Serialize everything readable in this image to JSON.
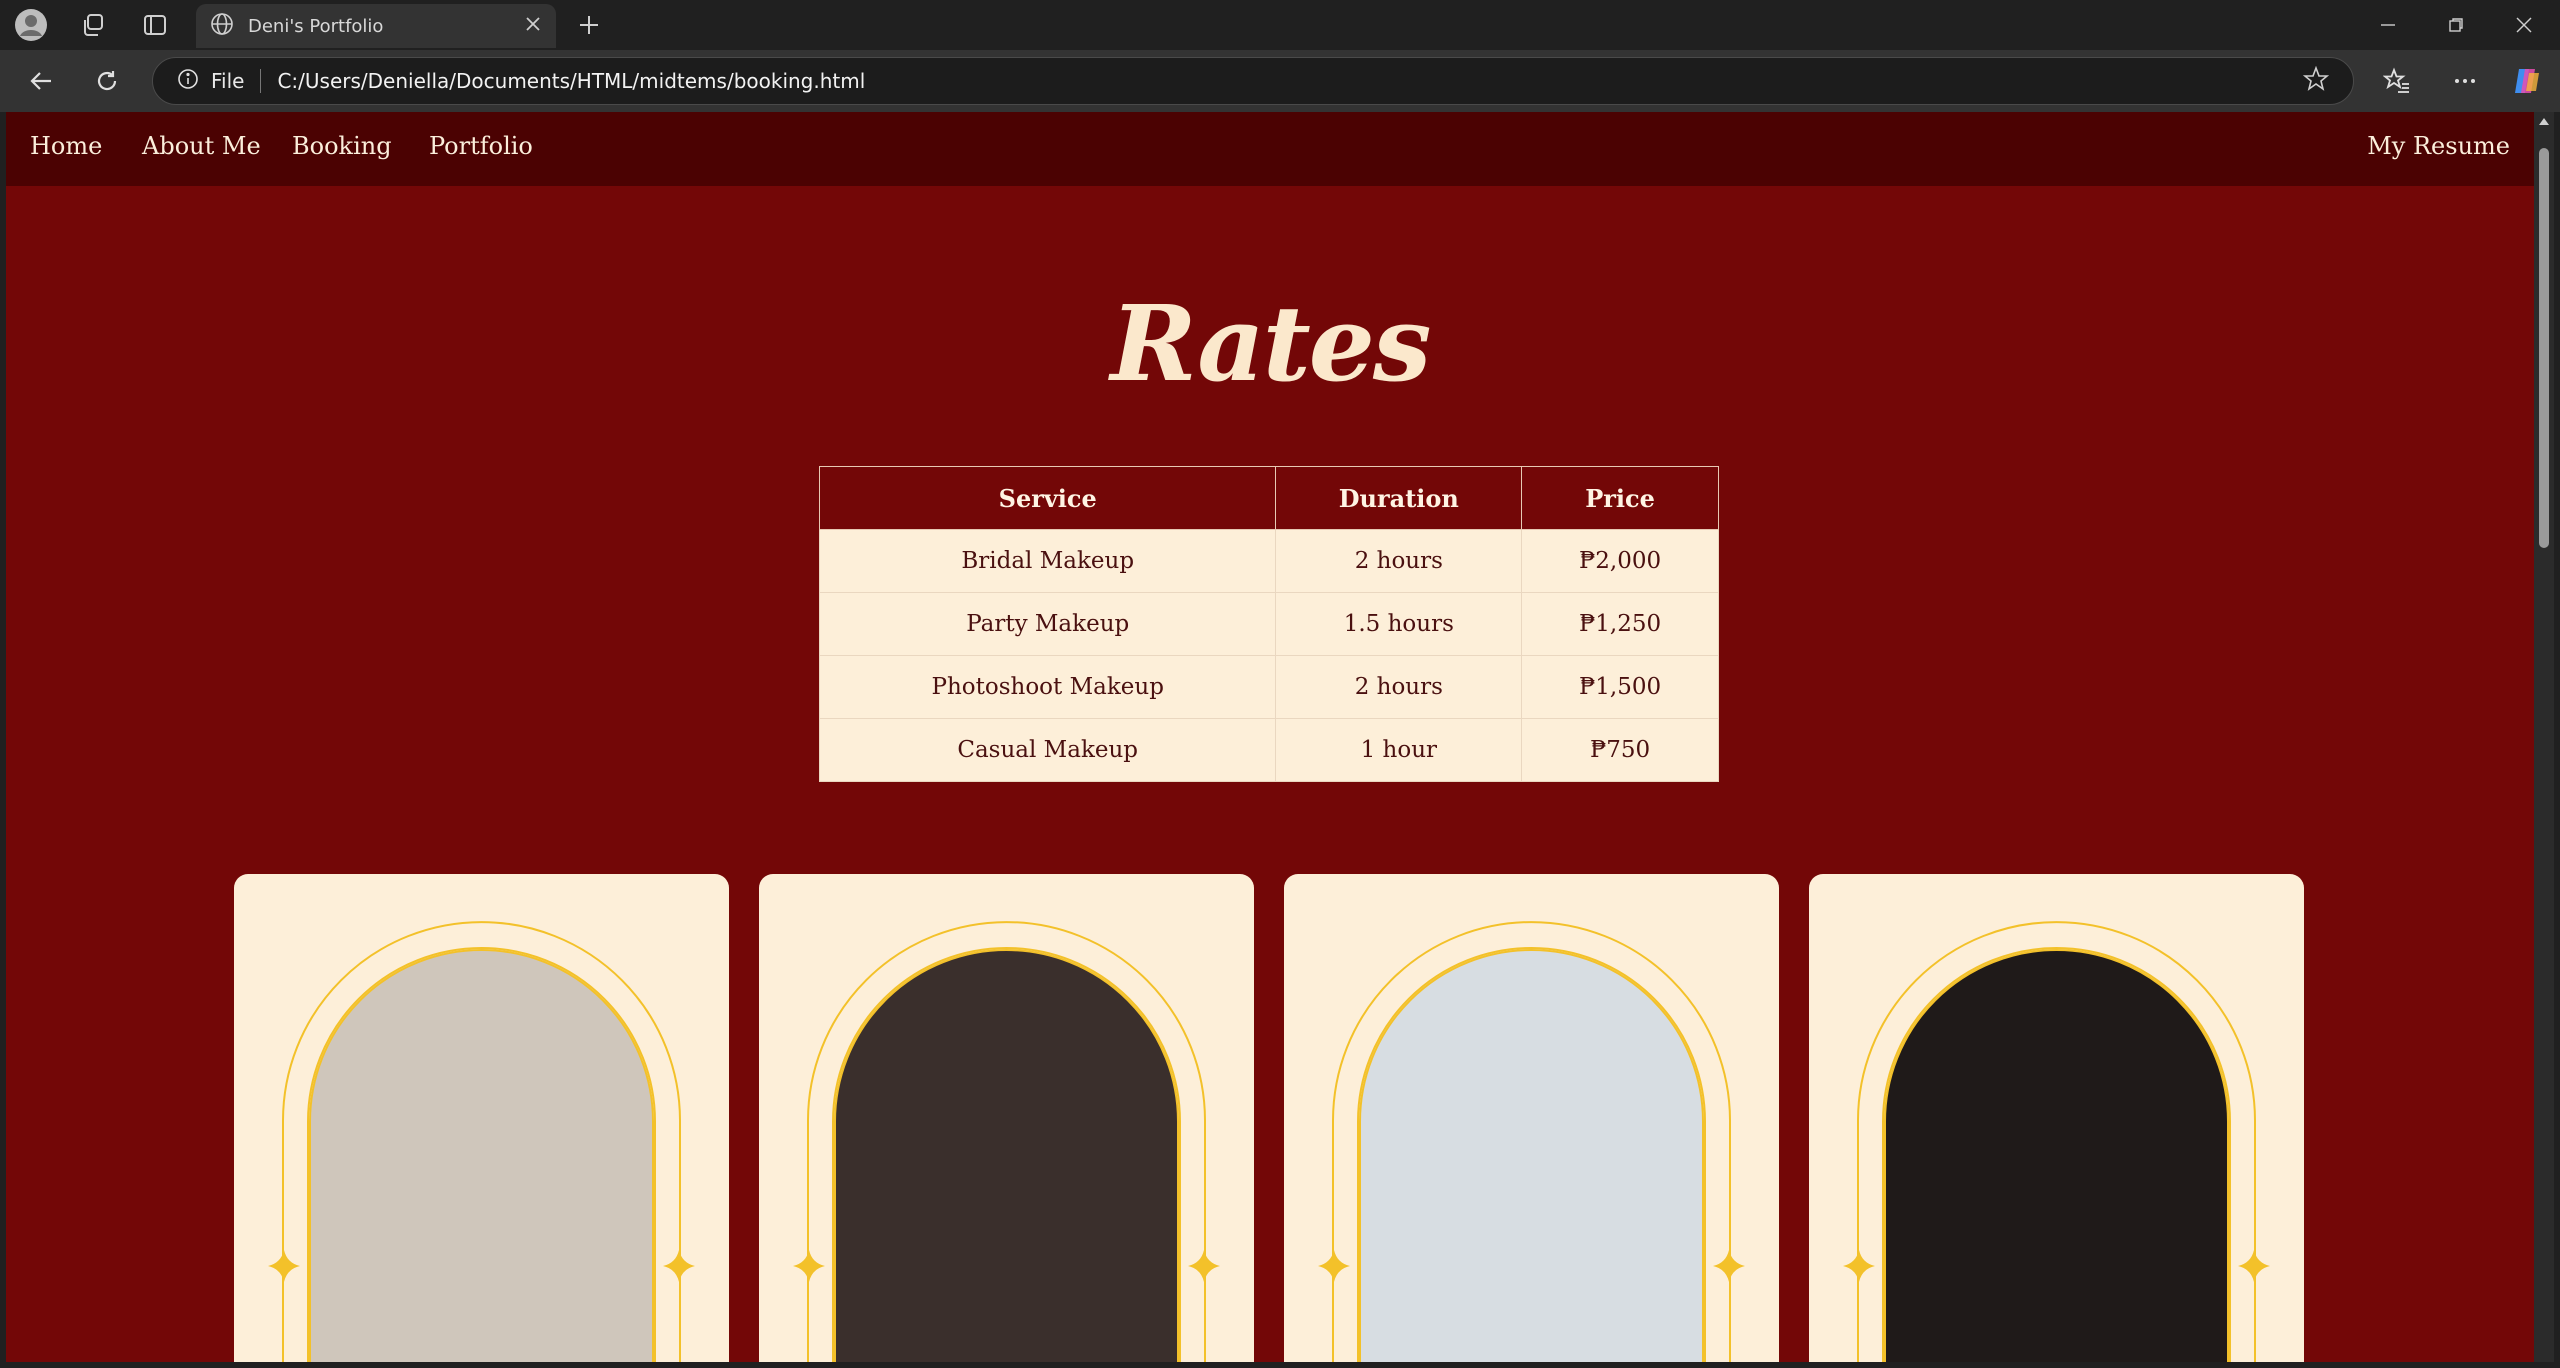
{
  "browser": {
    "tab_title": "Deni's Portfolio",
    "address_scheme": "File",
    "address_url": "C:/Users/Deniella/Documents/HTML/midtems/booking.html"
  },
  "nav": {
    "links": [
      "Home",
      "About Me",
      "Booking",
      "Portfolio"
    ],
    "right_link": "My Resume"
  },
  "rates": {
    "title": "Rates",
    "headers": [
      "Service",
      "Duration",
      "Price"
    ],
    "rows": [
      [
        "Bridal Makeup",
        "2 hours",
        "₱2,000"
      ],
      [
        "Party Makeup",
        "1.5 hours",
        "₱1,250"
      ],
      [
        "Photoshoot Makeup",
        "2 hours",
        "₱1,500"
      ],
      [
        "Casual Makeup",
        "1 hour",
        "₱750"
      ]
    ]
  },
  "cards": [
    {
      "photo": "bridal-makeup-portrait"
    },
    {
      "photo": "halloween-makeup-portrait"
    },
    {
      "photo": "cosplay-makeup-portrait"
    },
    {
      "photo": "casual-makeup-portrait"
    }
  ],
  "colors": {
    "page_bg": "#730707",
    "nav_bg": "#4b0202",
    "cream": "#fdefd9",
    "gold": "#f3c12a"
  }
}
